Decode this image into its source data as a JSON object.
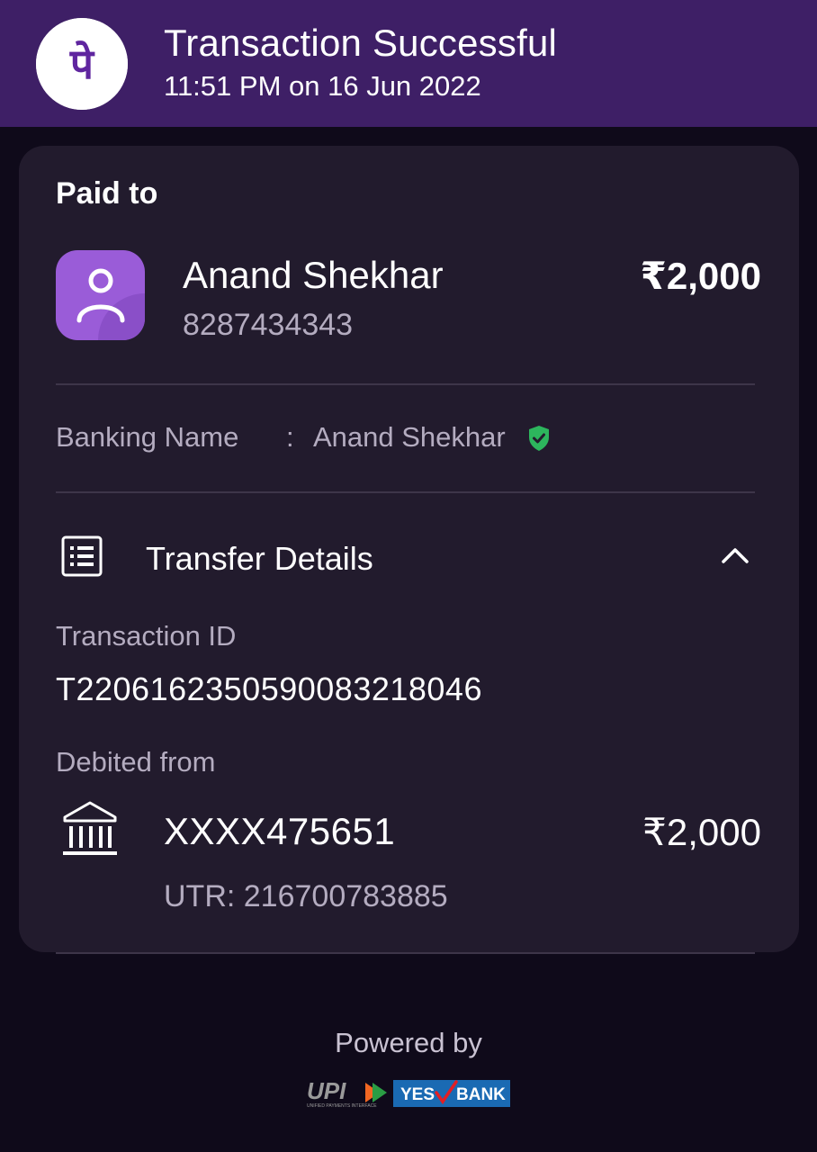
{
  "header": {
    "title": "Transaction Successful",
    "datetime": "11:51 PM on 16 Jun 2022",
    "logo_glyph": "पे",
    "brand_color": "#3e1f66"
  },
  "payee": {
    "section_label": "Paid to",
    "name": "Anand Shekhar",
    "phone": "8287434343",
    "amount": "₹2,000"
  },
  "banking": {
    "label": "Banking Name",
    "separator": ":",
    "value": "Anand Shekhar",
    "verified_color": "#2db55d"
  },
  "transfer": {
    "title": "Transfer Details",
    "txn_label": "Transaction ID",
    "txn_id": "T2206162350590083218046",
    "debited_label": "Debited from",
    "account": "XXXX475651",
    "account_amount": "₹2,000",
    "utr": "UTR: 216700783885"
  },
  "footer": {
    "powered_by": "Powered by",
    "upi_text": "UPI",
    "upi_tagline": "UNIFIED PAYMENTS INTERFACE",
    "bank_left": "YES",
    "bank_right": "BANK"
  }
}
